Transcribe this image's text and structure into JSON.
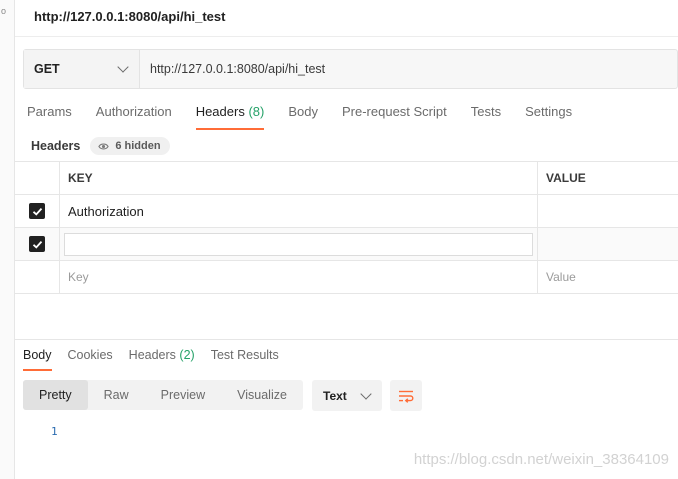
{
  "window": {
    "title": "http://127.0.0.1:8080/api/hi_test"
  },
  "gutter": {
    "mark": "o"
  },
  "request": {
    "method": "GET",
    "url": "http://127.0.0.1:8080/api/hi_test"
  },
  "request_tabs": {
    "params": "Params",
    "authorization": "Authorization",
    "headers": "Headers",
    "headers_count": "(8)",
    "body": "Body",
    "pre_request": "Pre-request Script",
    "tests": "Tests",
    "settings": "Settings"
  },
  "headers_section": {
    "label": "Headers",
    "hidden": "6 hidden"
  },
  "table": {
    "columns": {
      "key": "KEY",
      "value": "VALUE"
    },
    "rows": [
      {
        "key": "Authorization",
        "value": ""
      }
    ],
    "placeholder": {
      "key": "Key",
      "value": "Value"
    }
  },
  "response_tabs": {
    "body": "Body",
    "cookies": "Cookies",
    "headers": "Headers",
    "headers_count": "(2)",
    "test_results": "Test Results"
  },
  "view_modes": {
    "pretty": "Pretty",
    "raw": "Raw",
    "preview": "Preview",
    "visualize": "Visualize"
  },
  "format": {
    "selected": "Text"
  },
  "editor": {
    "line_number": "1"
  },
  "watermark": "https://blog.csdn.net/weixin_38364109",
  "colors": {
    "accent": "#ff6c37",
    "count_green": "#26a269",
    "checkbox": "#212121"
  }
}
